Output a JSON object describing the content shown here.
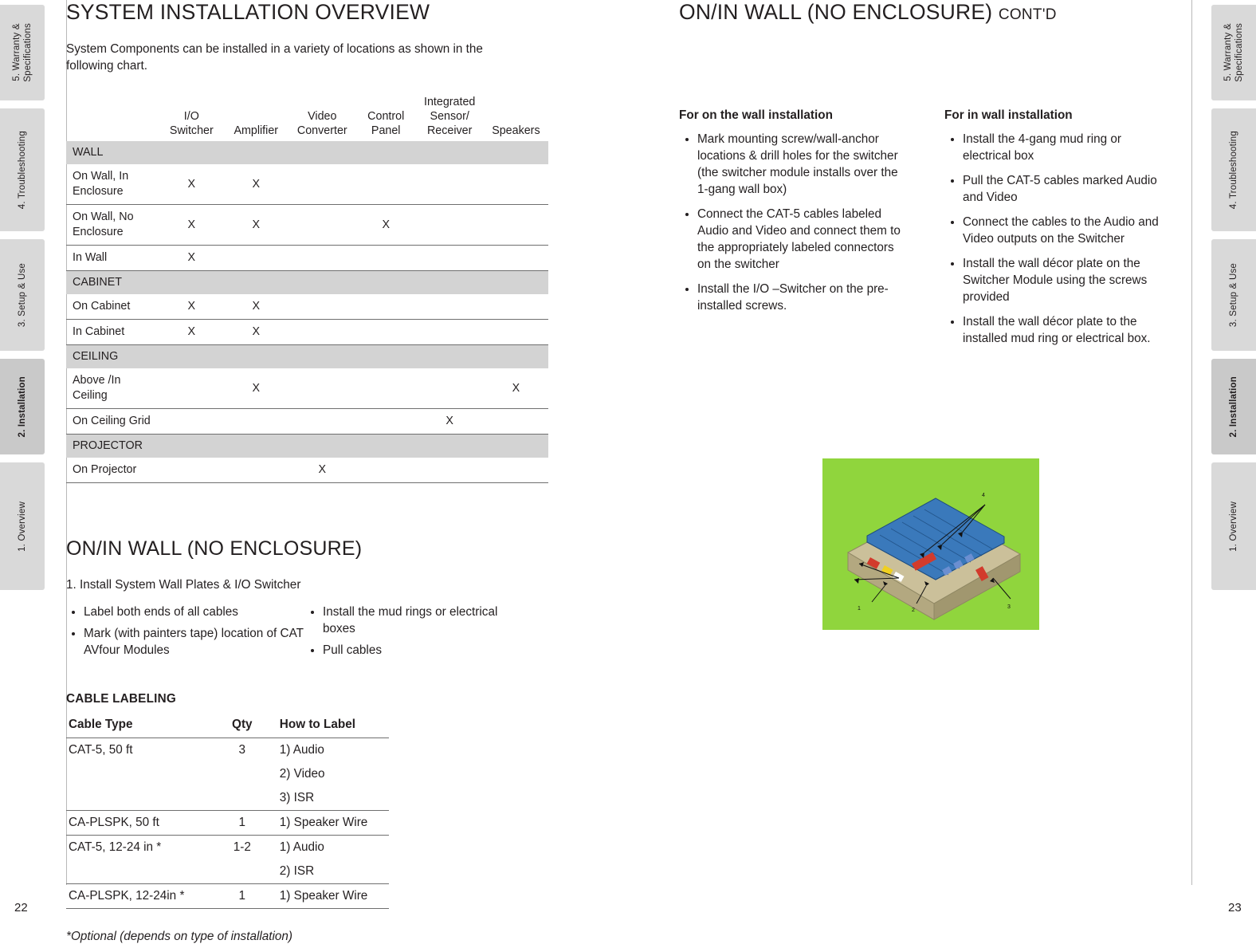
{
  "left_tabs": [
    {
      "label": "5. Warranty &\nSpecifications",
      "active": false,
      "bold": false
    },
    {
      "label": "4. Troubleshooting",
      "active": false,
      "bold": false
    },
    {
      "label": "3. Setup & Use",
      "active": false,
      "bold": false
    },
    {
      "label": "2. Installation",
      "active": true,
      "bold": true
    },
    {
      "label": "1. Overview",
      "active": false,
      "bold": false
    }
  ],
  "right_tabs": [
    {
      "label": "5. Warranty &\nSpecifications",
      "active": false,
      "bold": false
    },
    {
      "label": "4. Troubleshooting",
      "active": false,
      "bold": false
    },
    {
      "label": "3. Setup & Use",
      "active": false,
      "bold": false
    },
    {
      "label": "2. Installation",
      "active": true,
      "bold": true
    },
    {
      "label": "1. Overview",
      "active": false,
      "bold": false
    }
  ],
  "left_page": {
    "page_number": "22",
    "title": "SYSTEM INSTALLATION OVERVIEW",
    "intro": "System Components can be installed in a variety of locations as shown in the following chart.",
    "matrix": {
      "columns": [
        "",
        "I/O\nSwitcher",
        "Amplifier",
        "Video\nConverter",
        "Control\nPanel",
        "Integrated\nSensor/\nReceiver",
        "Speakers"
      ],
      "rows": [
        {
          "type": "section",
          "label": "WALL"
        },
        {
          "type": "data",
          "label": "On Wall, In Enclosure",
          "marks": [
            "X",
            "X",
            "",
            "",
            "",
            ""
          ]
        },
        {
          "type": "data",
          "label": "On Wall, No Enclosure",
          "marks": [
            "X",
            "X",
            "",
            "X",
            "",
            ""
          ]
        },
        {
          "type": "data",
          "label": "In Wall",
          "marks": [
            "X",
            "",
            "",
            "",
            "",
            ""
          ]
        },
        {
          "type": "section",
          "label": "CABINET"
        },
        {
          "type": "data",
          "label": "On Cabinet",
          "marks": [
            "X",
            "X",
            "",
            "",
            "",
            ""
          ]
        },
        {
          "type": "data",
          "label": "In Cabinet",
          "marks": [
            "X",
            "X",
            "",
            "",
            "",
            ""
          ]
        },
        {
          "type": "section",
          "label": "CEILING"
        },
        {
          "type": "data",
          "label": "Above /In Ceiling",
          "marks": [
            "",
            "X",
            "",
            "",
            "",
            "X"
          ]
        },
        {
          "type": "data",
          "label": "On Ceiling Grid",
          "marks": [
            "",
            "",
            "",
            "",
            "X",
            ""
          ]
        },
        {
          "type": "section",
          "label": "PROJECTOR"
        },
        {
          "type": "data",
          "label": "On Projector",
          "marks": [
            "",
            "",
            "X",
            "",
            "",
            ""
          ]
        }
      ]
    },
    "section2": {
      "title": "ON/IN WALL (NO ENCLOSURE)",
      "step1": "1.  Install System Wall Plates & I/O Switcher",
      "bullets_col1": [
        "Label both ends of all cables",
        "Mark (with painters tape) location of CAT AVfour Modules"
      ],
      "bullets_col2": [
        "Install the mud rings or electrical boxes",
        "Pull cables"
      ]
    },
    "cable_labeling": {
      "heading": "CABLE LABELING",
      "columns": [
        "Cable Type",
        "Qty",
        "How to Label"
      ],
      "rows": [
        {
          "type": "CAT-5, 50 ft",
          "qty": "3",
          "labels": [
            "1) Audio",
            "2) Video",
            "3) ISR"
          ]
        },
        {
          "type": "CA-PLSPK, 50 ft",
          "qty": "1",
          "labels": [
            "1) Speaker Wire"
          ]
        },
        {
          "type": "CAT-5, 12-24 in *",
          "qty": "1-2",
          "labels": [
            "1) Audio",
            "2) ISR"
          ]
        },
        {
          "type": "CA-PLSPK, 12-24in *",
          "qty": "1",
          "labels": [
            "1) Speaker Wire"
          ]
        }
      ],
      "footnote": "*Optional (depends on type of installation)"
    }
  },
  "right_page": {
    "page_number": "23",
    "title": "ON/IN WALL (NO ENCLOSURE)",
    "title_suffix": "CONT'D",
    "col1": {
      "heading": "For on the wall installation",
      "bullets": [
        "Mark mounting screw/wall-anchor locations & drill holes for the switcher (the switcher module installs over the 1-gang wall box)",
        "Connect the CAT-5 cables labeled Audio and Video and connect them to the appropriately labeled connectors on the switcher",
        "Install the I/O –Switcher on the pre-installed screws."
      ]
    },
    "col2": {
      "heading": "For in wall installation",
      "bullets": [
        "Install the 4-gang mud ring or electrical box",
        "Pull the CAT-5 cables marked Audio and Video",
        "Connect the cables to the Audio and Video outputs on the Switcher",
        "Install the wall décor plate on the Switcher Module using the screws provided",
        "Install the wall décor plate to the installed mud ring or electrical box."
      ]
    },
    "illustration": {
      "name": "switcher-module-diagram",
      "background": "#90d53d",
      "body_color": "#cbc09a",
      "lid_color": "#2b67a8"
    }
  }
}
